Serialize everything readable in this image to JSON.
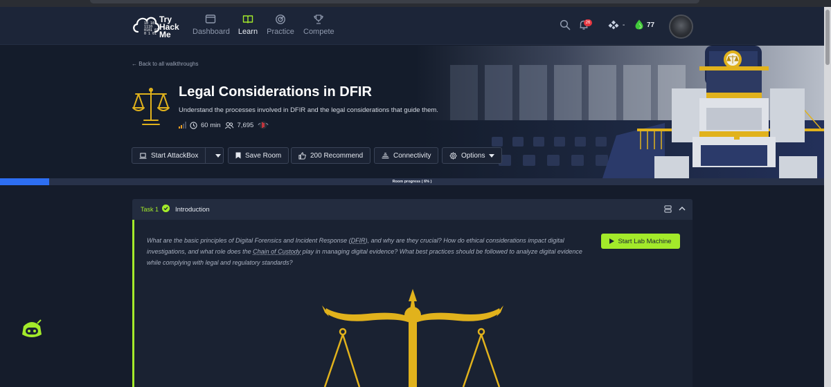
{
  "nav": {
    "logo": {
      "text": "Try\nHack\nMe",
      "binary": "10 10\n1110\n0101 01\n0 1 01"
    },
    "items": [
      {
        "label": "Dashboard",
        "icon": "monitor-icon"
      },
      {
        "label": "Learn",
        "icon": "book-icon",
        "active": true
      },
      {
        "label": "Practice",
        "icon": "target-icon"
      },
      {
        "label": "Compete",
        "icon": "trophy-icon"
      }
    ],
    "notifications": "26",
    "rank": "-",
    "streak": "77"
  },
  "room": {
    "back": "Back to all walkthroughs",
    "title": "Legal Considerations in DFIR",
    "subtitle": "Understand the processes involved in DFIR and the legal considerations that guide them.",
    "duration": "60 min",
    "users": "7,695",
    "difficulty_level": 0.25
  },
  "actions": {
    "attackbox": "Start AttackBox",
    "save": "Save Room",
    "recommend": "200 Recommend",
    "connectivity": "Connectivity",
    "options": "Options"
  },
  "progress": {
    "percent": 6,
    "label": "Room progress ( 6% )"
  },
  "task": {
    "number": "Task 1",
    "name": "Introduction",
    "text_parts": [
      "What are the basic principles of Digital Forensics and Incident Response (",
      "DFIR",
      "), and why are they crucial? How do ethical considerations impact digital investigations, and what role does the ",
      "Chain of Custody",
      " play in managing digital evidence? What best practices should be followed to analyze digital evidence while complying with legal and regulatory standards?"
    ],
    "lab_button": "Start Lab Machine"
  },
  "colors": {
    "accent_green": "#a3ea2a",
    "progress_blue": "#2d6ef2",
    "gold": "#e1b21c",
    "navbar": "#1c2538"
  }
}
